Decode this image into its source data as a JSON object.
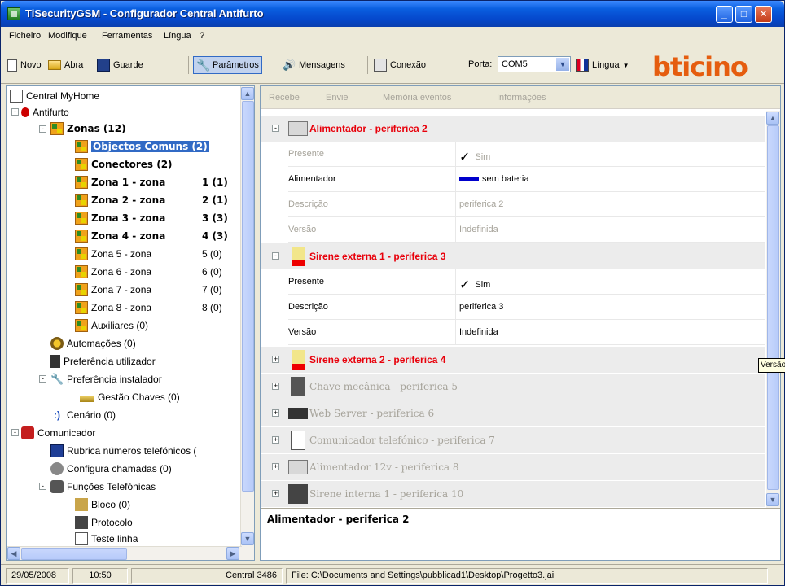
{
  "window": {
    "title": "TiSecurityGSM - Configurador Central Antifurto"
  },
  "menu": [
    "Ficheiro",
    "Modifique",
    "Ferramentas",
    "Língua",
    "?"
  ],
  "toolbar": {
    "novo": "Novo",
    "abra": "Abra",
    "guarde": "Guarde",
    "parametros": "Parâmetros",
    "mensagens": "Mensagens",
    "conexao": "Conexão",
    "porta_label": "Porta:",
    "porta_value": "COM5",
    "lingua": "Língua",
    "brand": "bticino"
  },
  "tree": {
    "root": "Central MyHome",
    "antifurto": "Antifurto",
    "zonas": "Zonas (12)",
    "objectos": "Objectos Comuns (2)",
    "conectores": "Conectores (2)",
    "zones": [
      {
        "label": "Zona 1 - zona",
        "count": "1 (1)",
        "bold": true
      },
      {
        "label": "Zona 2 - zona",
        "count": "2 (1)",
        "bold": true
      },
      {
        "label": "Zona 3 - zona",
        "count": "3 (3)",
        "bold": true
      },
      {
        "label": "Zona 4 - zona",
        "count": "4 (3)",
        "bold": true
      },
      {
        "label": "Zona 5 - zona",
        "count": "5 (0)",
        "bold": false
      },
      {
        "label": "Zona 6 - zona",
        "count": "6 (0)",
        "bold": false
      },
      {
        "label": "Zona 7 - zona",
        "count": "7 (0)",
        "bold": false
      },
      {
        "label": "Zona 8 - zona",
        "count": "8 (0)",
        "bold": false
      }
    ],
    "auxiliares": "Auxiliares (0)",
    "automacoes": "Automações (0)",
    "pref_utilizador": "Preferência utilizador",
    "pref_instalador": "Preferência instalador",
    "gestao_chaves": "Gestão Chaves (0)",
    "cenario": "Cenário (0)",
    "comunicador": "Comunicador",
    "rubrica": "Rubrica números telefónicos (",
    "configura": "Configura chamadas (0)",
    "funcoes": "Funções Telefónicas",
    "bloco": "Bloco (0)",
    "protocolo": "Protocolo",
    "teste": "Teste linha"
  },
  "subtoolbar": {
    "recebe": "Recebe",
    "envie": "Envie",
    "memoria": "Memória eventos",
    "informacoes": "Informações"
  },
  "groups": {
    "g1": {
      "title": "Alimentador - periferica 2",
      "rows": [
        {
          "k": "Presente",
          "v": "Sim"
        },
        {
          "k": "Alimentador",
          "v": "sem bateria"
        },
        {
          "k": "Descrição",
          "v": "periferica 2"
        },
        {
          "k": "Versão",
          "v": "Indefinida"
        }
      ]
    },
    "g2": {
      "title": "Sirene externa 1 - periferica 3",
      "rows": [
        {
          "k": "Presente",
          "v": "Sim"
        },
        {
          "k": "Descrição",
          "v": "periferica 3"
        },
        {
          "k": "Versão",
          "v": "Indefinida"
        }
      ]
    },
    "g3": "Sirene externa 2 - periferica 4",
    "g4": "Chave mecânica - periferica 5",
    "g5": "Web Server - periferica 6",
    "g6": "Comunicador telefónico - periferica 7",
    "g7": "Alimentador 12v - periferica 8",
    "g8": "Sirene interna 1 - periferica 10"
  },
  "description": "Alimentador - periferica 2",
  "tooltip": "Versão",
  "status": {
    "date": "29/05/2008",
    "time": "10:50",
    "central": "Central 3486",
    "file": "File: C:\\Documents and Settings\\pubblicad1\\Desktop\\Progetto3.jai"
  },
  "colors": {
    "accent": "#316ac5",
    "group_title_active": "#e8000b",
    "brand": "#e55d0f"
  }
}
